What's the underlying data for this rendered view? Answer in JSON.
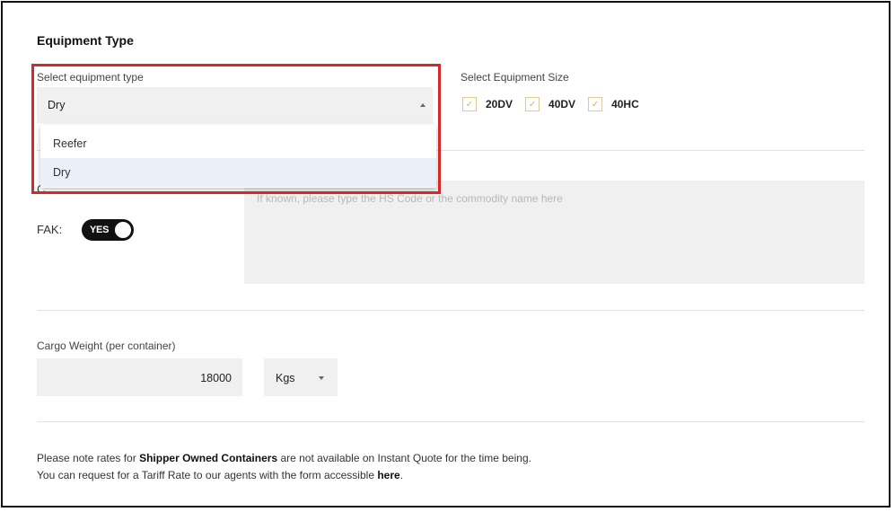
{
  "section": {
    "title": "Equipment Type"
  },
  "equipment_type": {
    "label": "Select equipment type",
    "selected": "Dry",
    "caret_icon": "caret-up-icon",
    "options": [
      {
        "label": "Reefer",
        "selected": false
      },
      {
        "label": "Dry",
        "selected": true
      }
    ]
  },
  "equipment_size": {
    "label": "Select Equipment Size",
    "options": [
      {
        "label": "20DV",
        "checked": true
      },
      {
        "label": "40DV",
        "checked": true
      },
      {
        "label": "40HC",
        "checked": true
      }
    ]
  },
  "commodity": {
    "label_partial": "C",
    "placeholder": "If known, please type the HS Code or the commodity name here"
  },
  "fak": {
    "label": "FAK:",
    "toggle_text": "YES",
    "value": true
  },
  "cargo_weight": {
    "label": "Cargo Weight (per container)",
    "value": "18000",
    "unit": "Kgs"
  },
  "note": {
    "line1_pre": "Please note rates for ",
    "line1_bold": "Shipper Owned Containers",
    "line1_post": " are not available on Instant Quote for the time being.",
    "line2_pre": "You can request for a Tariff Rate to our agents with the form accessible ",
    "line2_link": "here",
    "line2_post": "."
  },
  "colors": {
    "highlight": "#d9262b",
    "checkbox_accent": "#e8b040",
    "field_bg": "#f0f0f0",
    "toggle_bg": "#111111"
  }
}
